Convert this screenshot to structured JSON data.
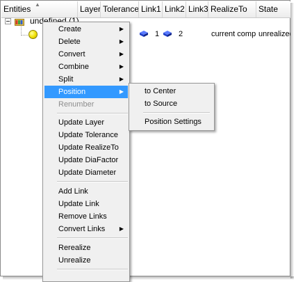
{
  "table": {
    "columns": [
      "Entities",
      "Layer",
      "Tolerance",
      "Link1",
      "Link2",
      "Link3",
      "RealizeTo",
      "State"
    ],
    "root": {
      "label": "undefined (1)",
      "expander": "minus"
    },
    "child_row": {
      "link1_value": "1",
      "link2_value": "2",
      "realize_to": "current comp",
      "state": "unrealized"
    }
  },
  "context_menu": {
    "items": [
      {
        "label": "Create",
        "submenu": true
      },
      {
        "label": "Delete",
        "submenu": true
      },
      {
        "label": "Convert",
        "submenu": true
      },
      {
        "label": "Combine",
        "submenu": true
      },
      {
        "label": "Split",
        "submenu": true
      },
      {
        "label": "Position",
        "submenu": true,
        "highlighted": true
      },
      {
        "label": "Renumber",
        "disabled": true
      },
      {
        "label": "Update Layer"
      },
      {
        "label": "Update Tolerance"
      },
      {
        "label": "Update RealizeTo"
      },
      {
        "label": "Update DiaFactor"
      },
      {
        "label": "Update Diameter"
      },
      {
        "label": "Add Link"
      },
      {
        "label": "Update Link"
      },
      {
        "label": "Remove Links"
      },
      {
        "label": "Convert Links",
        "submenu": true
      },
      {
        "label": "Rerealize"
      },
      {
        "label": "Unrealize"
      }
    ]
  },
  "position_submenu": {
    "items": [
      {
        "label": "to Center"
      },
      {
        "label": "to Source"
      },
      {
        "label": "Position Settings"
      }
    ]
  },
  "colors": {
    "highlight": "#3399ff",
    "menu_background": "#f0f0f0",
    "ball": "#f0e000",
    "cube": "#1f3fc9"
  },
  "icons": {
    "submenu_arrow": "▶",
    "sort": "▲"
  }
}
